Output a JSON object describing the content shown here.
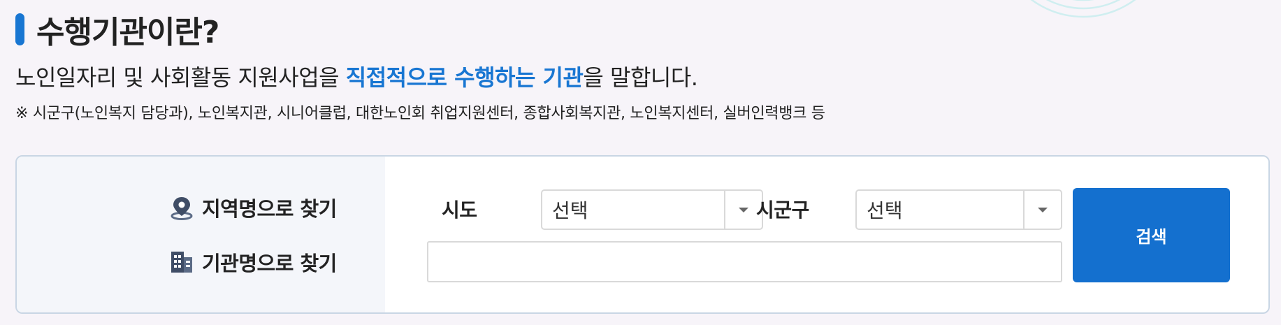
{
  "header": {
    "title": "수행기관이란?",
    "desc_prefix": "노인일자리 및 사회활동 지원사업을 ",
    "desc_highlight": "직접적으로 수행하는 기관",
    "desc_suffix": "을 말합니다.",
    "note": "※ 시군구(노인복지 담당과), 노인복지관, 시니어클럽, 대한노인회 취업지원센터, 종합사회복지관, 노인복지센터, 실버인력뱅크 등"
  },
  "search": {
    "region_label": "지역명으로 찾기",
    "region_icon": "location-pin-icon",
    "org_label": "기관명으로 찾기",
    "org_icon": "building-icon",
    "sido_label": "시도",
    "sido_value": "선택",
    "sigungu_label": "시군구",
    "sigungu_value": "선택",
    "org_input_value": "",
    "org_input_placeholder": "",
    "button_label": "검색"
  },
  "colors": {
    "accent": "#1876d2",
    "button": "#1470cf",
    "background": "#f7f4f9",
    "box_border": "#c9d6e4"
  }
}
